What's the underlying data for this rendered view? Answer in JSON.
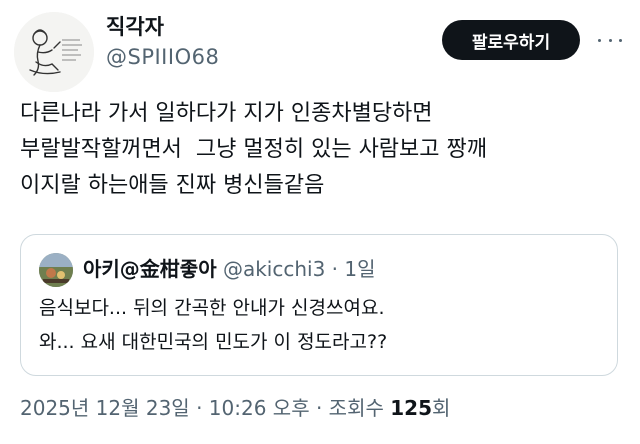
{
  "author": {
    "display_name": "직각자",
    "handle": "@SPIIIO68",
    "avatar_icon": "sketch-avatar-icon"
  },
  "follow_button_label": "팔로우하기",
  "more_icon": "more-dots-icon",
  "tweet_lines": [
    "다른나라 가서 일하다가 지가 인종차별당하면",
    "부랄발작할꺼면서  그냥 멀정히 있는 사람보고 짱깨",
    "이지랄 하는애들 진짜 병신들같음"
  ],
  "quoted_tweet": {
    "display_name": "아키@金柑좋아",
    "handle": "@akicchi3",
    "separator": " · ",
    "time": "1일",
    "avatar_icon": "photo-avatar-icon",
    "lines": [
      "음식보다... 뒤의 간곡한 안내가 신경쓰여요.",
      "와... 요새 대한민국의 민도가 이 정도라고??"
    ]
  },
  "footer": {
    "date": "2025년 12월 23일",
    "separator": " · ",
    "time": "10:26 오후",
    "views_label": "조회수 ",
    "views_count": "125",
    "views_unit": "회"
  },
  "colors": {
    "primary_text": "#0f1419",
    "secondary_text": "#536471",
    "border": "#cfd9de",
    "button_bg": "#0f1419"
  }
}
